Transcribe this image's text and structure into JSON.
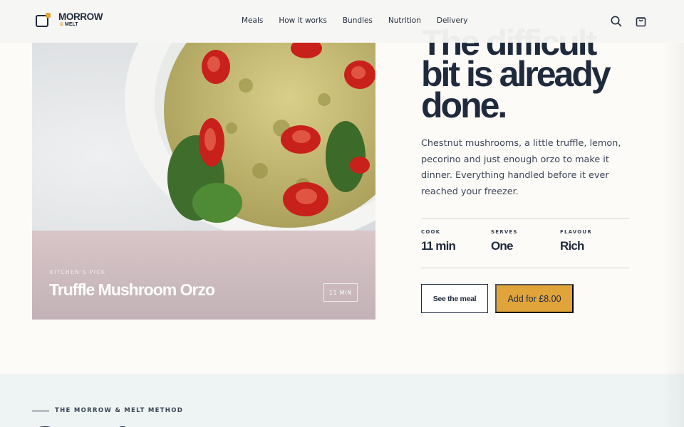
{
  "brand": {
    "name": "MORROW",
    "sub_amp": "&",
    "sub_word": "MELT"
  },
  "nav": {
    "items": [
      "Meals",
      "How it works",
      "Bundles",
      "Nutrition",
      "Delivery"
    ]
  },
  "header_icons": [
    "search-icon",
    "cart-icon"
  ],
  "hero_card": {
    "eyebrow": "KITCHEN'S PICK",
    "title": "Truffle Mushroom Orzo",
    "time_badge": "11 MIN"
  },
  "headline": {
    "lines": [
      "The difficult",
      "bit is already",
      "done."
    ]
  },
  "description": "Chestnut mushrooms, a little truffle, lemon, pecorino and just enough orzo to make it dinner. Everything handled before it ever reached your freezer.",
  "stats": [
    {
      "label": "COOK",
      "value": "11 min"
    },
    {
      "label": "SERVES",
      "value": "One"
    },
    {
      "label": "FLAVOUR",
      "value": "Rich"
    }
  ],
  "actions": {
    "secondary": "See the meal",
    "primary": "Add for £8.00"
  },
  "method": {
    "label": "THE MORROW & MELT METHOD"
  },
  "colors": {
    "navy": "#1f2b3d",
    "accent": "#e1a43b",
    "card_footer": "#d8c6c8",
    "band": "#eef3f4"
  }
}
